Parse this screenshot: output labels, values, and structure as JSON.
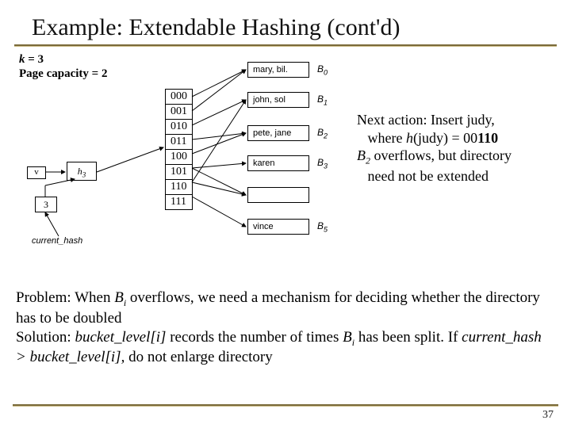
{
  "title": "Example: Extendable Hashing (cont'd)",
  "params": {
    "k_label": "k",
    "k_eq": " = 3",
    "cap": "Page capacity = 2"
  },
  "directory": [
    "000",
    "001",
    "010",
    "011",
    "100",
    "101",
    "110",
    "111"
  ],
  "buckets": [
    {
      "contents": "mary, bil.",
      "label": "B",
      "sub": "0"
    },
    {
      "contents": "john, sol",
      "label": "B",
      "sub": "1"
    },
    {
      "contents": "pete, jane",
      "label": "B",
      "sub": "2"
    },
    {
      "contents": "karen",
      "label": "B",
      "sub": "3"
    },
    {
      "contents": "",
      "label": "",
      "sub": ""
    },
    {
      "contents": "vince",
      "label": "B",
      "sub": "5"
    }
  ],
  "left": {
    "v": "v",
    "hbox_h": "h",
    "hbox_sub": "3",
    "three": "3",
    "current_hash": "current_hash"
  },
  "action": {
    "l1a": "Next action:  Insert judy,",
    "l2a": "where ",
    "l2h": "h",
    "l2b": "(judy)",
    "l2c": " = 00",
    "l2d": "110",
    "l3a": "B",
    "l3sub": "2",
    "l3b": " overflows, but directory",
    "l4": "need not be extended"
  },
  "bottom": {
    "p_lead": "Problem",
    "p_rest1": ":  When ",
    "p_bi": "B",
    "p_bi_sub": "i",
    "p_rest2": " overflows, we need a mechanism for deciding whether the directory has to be doubled",
    "s_lead": "Solution",
    "s_rest1": ":  ",
    "s_bl": "bucket_level[i]",
    "s_rest2": " records the number of times ",
    "s_bi": "B",
    "s_bi_sub": "i",
    "s_rest3": " has been split.  If ",
    "s_ch": "current_hash > bucket_level[i],",
    "s_rest4": " do not enlarge directory"
  },
  "pagenum": "37"
}
